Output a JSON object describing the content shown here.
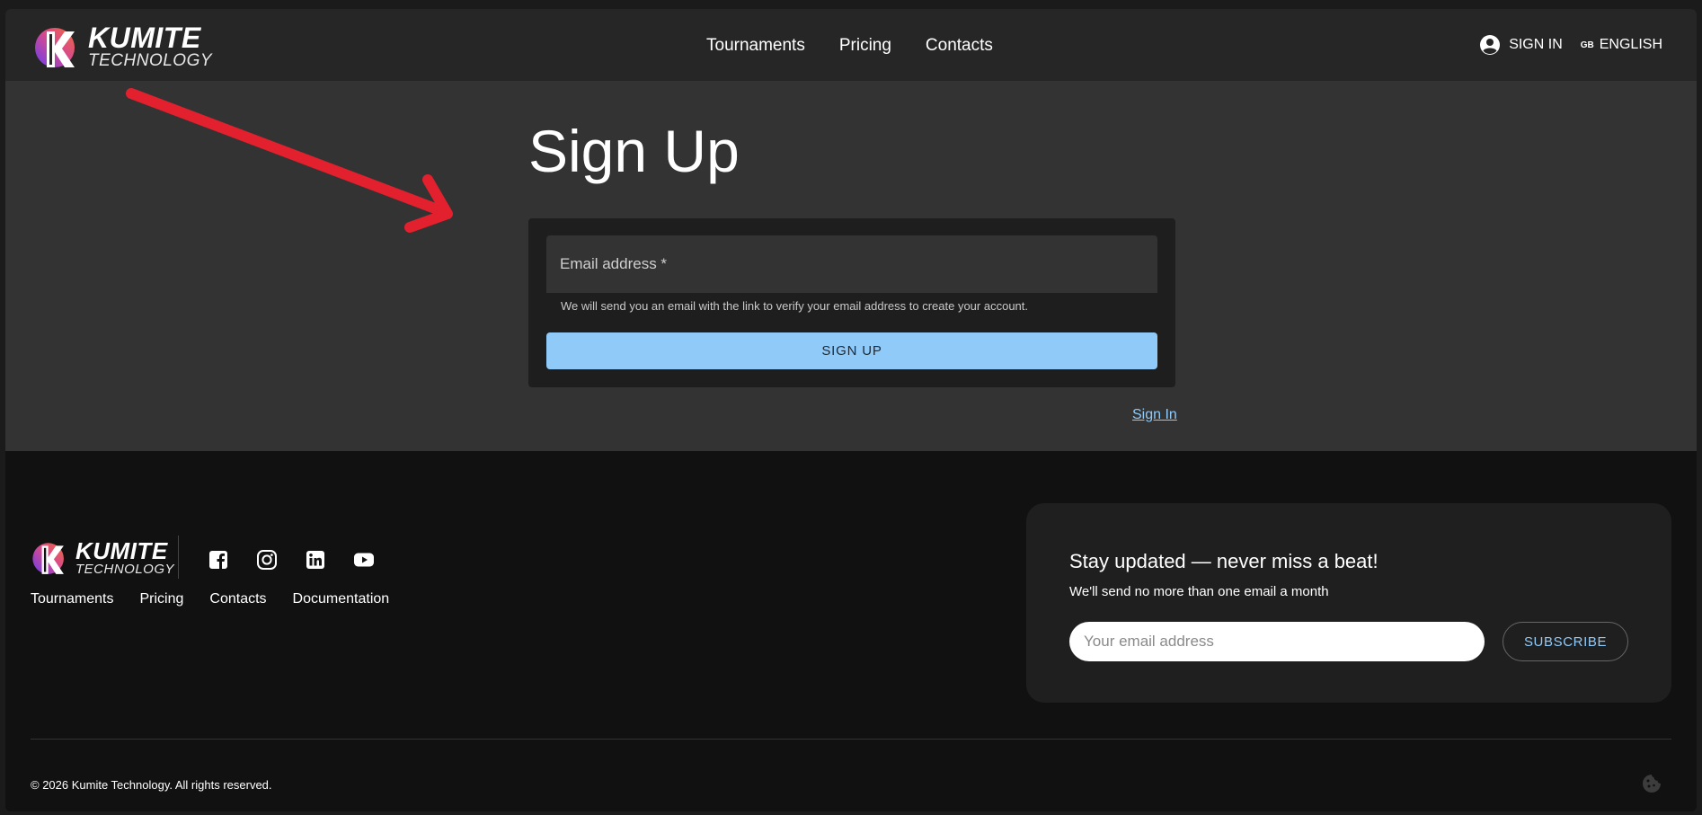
{
  "brand": {
    "name": "KUMITE",
    "sub": "TECHNOLOGY"
  },
  "nav": {
    "items": [
      "Tournaments",
      "Pricing",
      "Contacts"
    ]
  },
  "header_right": {
    "sign_in": "SIGN IN",
    "lang_code": "GB",
    "language": "ENGLISH"
  },
  "page": {
    "title": "Sign Up",
    "email_label": "Email address *",
    "helper": "We will send you an email with the link to verify your email address to create your account.",
    "signup_button": "SIGN UP",
    "signin_link": "Sign In"
  },
  "footer": {
    "links": [
      "Tournaments",
      "Pricing",
      "Contacts",
      "Documentation"
    ],
    "socials": [
      "facebook-icon",
      "instagram-icon",
      "linkedin-icon",
      "youtube-icon"
    ],
    "newsletter": {
      "title": "Stay updated — never miss a beat!",
      "subtitle": "We'll send no more than one email a month",
      "placeholder": "Your email address",
      "button": "SUBSCRIBE"
    },
    "copyright": "© 2026 Kumite Technology. All rights reserved."
  },
  "colors": {
    "accent": "#90caf9",
    "arrow": "#e3202e"
  }
}
